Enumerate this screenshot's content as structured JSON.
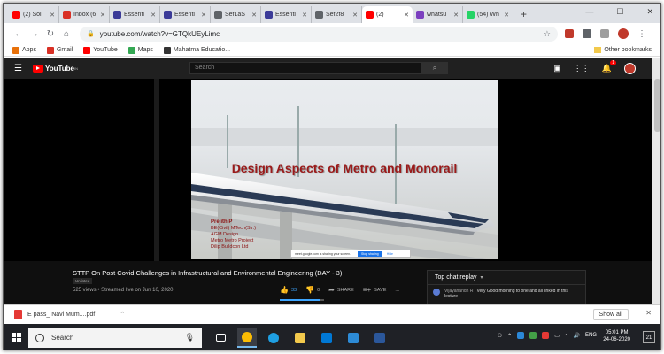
{
  "browser": {
    "tabs": [
      {
        "title": "(2) Soli",
        "color": "#ff0000"
      },
      {
        "title": "Inbox (6",
        "color": "#d93025"
      },
      {
        "title": "Essenti",
        "color": "#3b3b98"
      },
      {
        "title": "Essenti",
        "color": "#3b3b98"
      },
      {
        "title": "Sef1aS",
        "color": "#5f6368"
      },
      {
        "title": "Essenti",
        "color": "#3b3b98"
      },
      {
        "title": "Sef2f8",
        "color": "#5f6368"
      },
      {
        "title": "(2)",
        "color": "#ff0000"
      },
      {
        "title": "whatsu",
        "color": "#7b3fbf"
      },
      {
        "title": "(54) Wh",
        "color": "#25d366"
      }
    ],
    "active_tab_index": 7,
    "new_tab": "+",
    "window_controls": {
      "minimize": "—",
      "maximize": "☐",
      "close": "✕"
    },
    "nav": {
      "back": "←",
      "forward": "→",
      "reload": "↻",
      "home": "⌂"
    },
    "url": "youtube.com/watch?v=GTQkUEyLimc",
    "bookmarks": [
      {
        "label": "Apps",
        "color": "#e8710a"
      },
      {
        "label": "Gmail",
        "color": "#d93025"
      },
      {
        "label": "YouTube",
        "color": "#ff0000"
      },
      {
        "label": "Maps",
        "color": "#34a853"
      },
      {
        "label": "Mahatma Educatio...",
        "color": "#333333"
      }
    ],
    "other_bookmarks": "Other bookmarks"
  },
  "youtube": {
    "logo_text": "YouTube",
    "logo_sup": "IN",
    "search_placeholder": "Search",
    "notif_count": "1",
    "slide": {
      "title": "Design Aspects of Metro and Monorail",
      "presenter_lines": [
        "Prejith P",
        "BE(Civil) MTech(Str.)",
        "AGM Design",
        "Metro Metro Project",
        "Dilip Buildcon Ltd"
      ],
      "share_text": "meet.google.com is sharing your screen.",
      "stop_sharing": "Stop sharing",
      "hide": "Hide"
    },
    "video_title": "STTP On Post Covid Challenges in Infrastructural and Environmental Engineering (DAY - 3)",
    "unlisted": "Unlisted",
    "meta": "525 views • Streamed live on Jun 10, 2020",
    "likes": "33",
    "dislikes": "0",
    "share_label": "SHARE",
    "save_label": "SAVE",
    "more_label": "...",
    "like_ratio": 0.9,
    "chat": {
      "header": "Top chat replay",
      "author": "Vijayanandh R",
      "message": "Very Good morning to one and all linked in this lecture"
    }
  },
  "downloads": {
    "file": "E pass_ Navi Mum....pdf",
    "show_all": "Show all",
    "close": "✕"
  },
  "taskbar": {
    "search_placeholder": "Search",
    "apps": [
      {
        "name": "task-view",
        "color": "#ffffff"
      },
      {
        "name": "chrome",
        "color": "#fbbc04"
      },
      {
        "name": "edge",
        "color": "#1fa0e3"
      },
      {
        "name": "file-explorer",
        "color": "#f2c94c"
      },
      {
        "name": "store",
        "color": "#0078d4"
      },
      {
        "name": "photos",
        "color": "#2d8bd6"
      },
      {
        "name": "word",
        "color": "#2b579a"
      }
    ],
    "language": "ENG",
    "time": "05:01 PM",
    "date": "24-06-2020",
    "notifications": "21"
  }
}
